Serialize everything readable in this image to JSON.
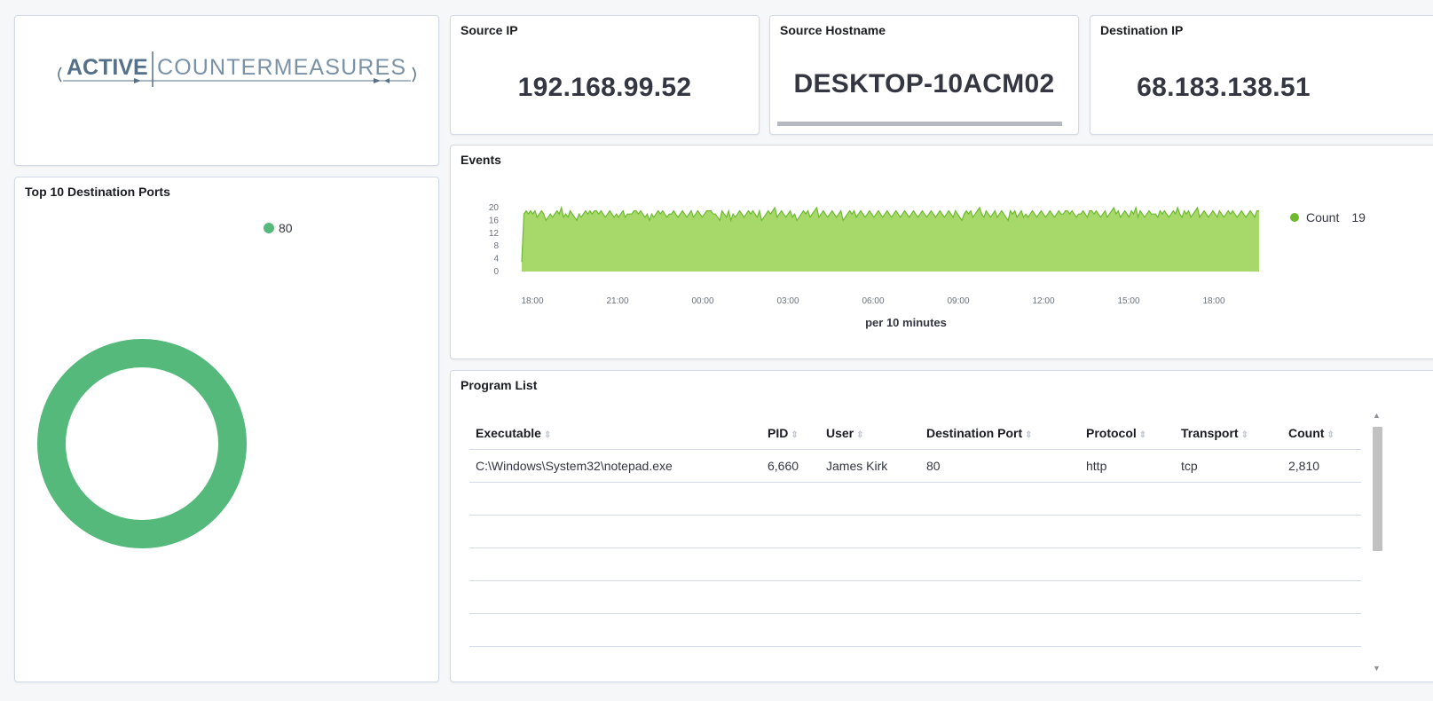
{
  "logo": {
    "brand_bold": "ACTIVE",
    "brand_light": "COUNTERMEASURES"
  },
  "metrics": {
    "source_ip": {
      "label": "Source IP",
      "value": "192.168.99.52"
    },
    "source_hostname": {
      "label": "Source Hostname",
      "value": "DESKTOP-10ACM02"
    },
    "destination_ip": {
      "label": "Destination IP",
      "value": "68.183.138.51"
    }
  },
  "ports_panel": {
    "title": "Top 10 Destination Ports",
    "legend": [
      "80"
    ],
    "color": "#54b97a"
  },
  "events_panel": {
    "title": "Events",
    "legend_label": "Count",
    "legend_value": "19",
    "color": "#a6d96a",
    "line_color": "#6dba2f"
  },
  "chart_data": {
    "type": "area",
    "title": "Events",
    "xlabel": "per 10 minutes",
    "ylabel": "",
    "x_ticks": [
      "18:00",
      "21:00",
      "00:00",
      "03:00",
      "06:00",
      "09:00",
      "12:00",
      "15:00",
      "18:00"
    ],
    "y_ticks": [
      "0",
      "4",
      "8",
      "12",
      "16",
      "20"
    ],
    "ylim": [
      0,
      20
    ],
    "series": [
      {
        "name": "Count",
        "values": [
          3,
          18,
          19,
          18,
          19,
          18,
          19,
          17,
          18,
          19,
          18,
          16,
          17,
          18,
          17,
          18,
          19,
          18,
          20,
          17,
          18,
          17,
          19,
          18,
          17,
          16,
          18,
          17,
          18,
          19,
          18,
          19,
          18,
          19,
          19,
          18,
          19,
          18,
          17,
          18,
          19,
          18,
          17,
          18,
          17,
          18,
          19,
          17,
          18,
          18,
          18,
          19,
          19,
          18,
          19,
          18,
          17,
          18,
          16,
          18,
          17,
          18,
          19,
          18,
          19,
          18,
          17,
          18,
          18,
          19,
          18,
          17,
          18,
          19,
          18,
          17,
          18,
          19,
          17,
          18,
          19,
          18,
          17,
          18,
          19,
          19,
          19,
          18,
          18,
          17,
          16,
          19,
          18,
          17,
          19,
          16,
          18,
          17,
          18,
          19,
          18,
          17,
          18,
          19,
          18,
          19,
          18,
          17,
          19,
          16,
          17,
          18,
          19,
          18,
          19,
          20,
          17,
          18,
          19,
          18,
          17,
          18,
          19,
          17,
          18,
          16,
          17,
          18,
          19,
          18,
          19,
          17,
          18,
          19,
          20,
          17,
          18,
          19,
          18,
          17,
          18,
          19,
          18,
          17,
          18,
          19,
          16,
          17,
          18,
          19,
          18,
          19,
          17,
          18,
          19,
          18,
          17,
          18,
          19,
          18,
          17,
          18,
          19,
          18,
          17,
          18,
          19,
          18,
          17,
          18,
          19,
          18,
          17,
          18,
          19,
          18,
          17,
          18,
          19,
          18,
          17,
          18,
          19,
          18,
          17,
          18,
          19,
          18,
          17,
          18,
          19,
          18,
          17,
          18,
          19,
          18,
          17,
          19,
          18,
          17,
          16,
          18,
          19,
          18,
          19,
          17,
          18,
          19,
          20,
          18,
          17,
          19,
          18,
          17,
          18,
          19,
          17,
          18,
          19,
          18,
          17,
          16,
          19,
          18,
          19,
          17,
          18,
          19,
          17,
          18,
          17,
          18,
          19,
          18,
          17,
          18,
          19,
          18,
          17,
          18,
          19,
          18,
          17,
          18,
          19,
          18,
          18,
          19,
          19,
          18,
          19,
          18,
          17,
          18,
          18,
          19,
          18,
          17,
          19,
          19,
          18,
          19,
          18,
          17,
          18,
          19,
          17,
          18,
          19,
          20,
          18,
          19,
          17,
          18,
          19,
          18,
          17,
          19,
          18,
          20,
          17,
          19,
          18,
          17,
          18,
          19,
          18,
          18,
          18,
          17,
          19,
          18,
          19,
          18,
          17,
          18,
          19,
          18,
          20,
          18,
          17,
          19,
          18,
          19,
          17,
          18,
          19,
          20,
          17,
          18,
          19,
          18,
          17,
          18,
          19,
          18,
          17,
          19,
          18,
          17,
          18,
          19,
          18,
          19,
          18,
          17,
          18,
          19,
          18,
          17,
          18,
          19,
          18,
          17,
          19,
          19
        ]
      }
    ]
  },
  "program_list": {
    "title": "Program List",
    "columns": [
      "Executable",
      "PID",
      "User",
      "Destination Port",
      "Protocol",
      "Transport",
      "Count"
    ],
    "rows": [
      [
        "C:\\Windows\\System32\\notepad.exe",
        "6,660",
        "James Kirk",
        "80",
        "http",
        "tcp",
        "2,810"
      ]
    ],
    "sort_icon": "sort-arrows"
  }
}
